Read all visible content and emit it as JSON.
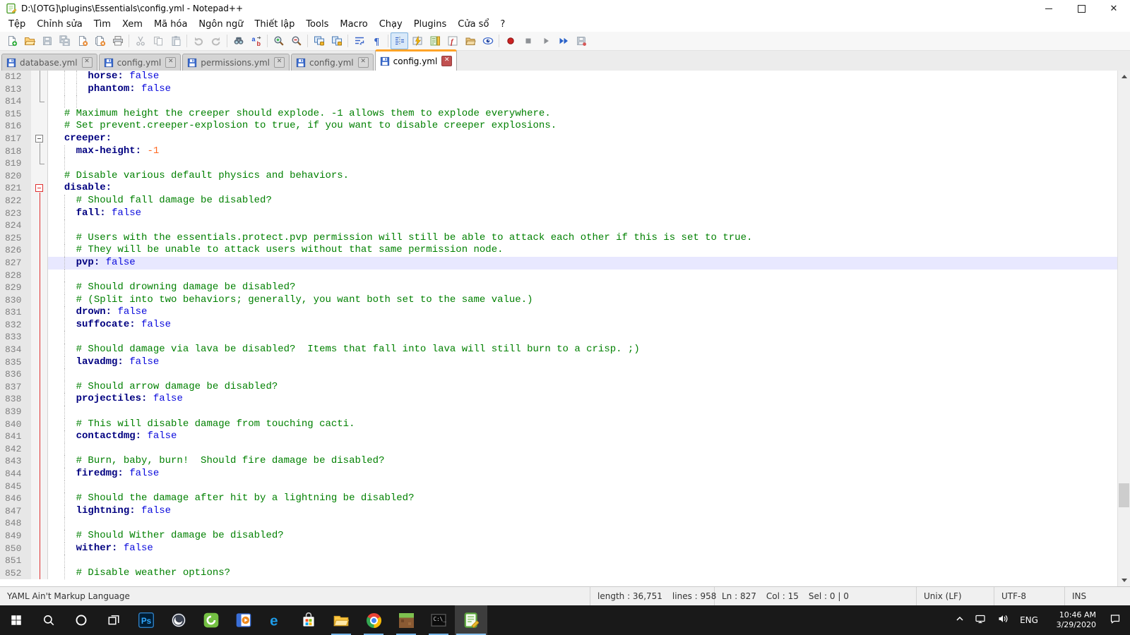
{
  "window": {
    "title": "D:\\[OTG]\\plugins\\Essentials\\config.yml - Notepad++",
    "controls": [
      "minimize",
      "maximize",
      "close"
    ]
  },
  "menu": {
    "items": [
      "Tệp",
      "Chỉnh sửa",
      "Tìm",
      "Xem",
      "Mã hóa",
      "Ngôn ngữ",
      "Thiết lập",
      "Tools",
      "Macro",
      "Chạy",
      "Plugins",
      "Cửa sổ",
      "?"
    ]
  },
  "toolbar": {
    "groups": [
      [
        {
          "n": "new-file",
          "s": ""
        },
        {
          "n": "open-file",
          "s": ""
        },
        {
          "n": "save",
          "s": "d"
        },
        {
          "n": "save-all",
          "s": "d"
        },
        {
          "n": "close-file",
          "s": ""
        },
        {
          "n": "close-all",
          "s": ""
        },
        {
          "n": "print",
          "s": ""
        }
      ],
      [
        {
          "n": "cut",
          "s": "d"
        },
        {
          "n": "copy",
          "s": "d"
        },
        {
          "n": "paste",
          "s": "d"
        }
      ],
      [
        {
          "n": "undo",
          "s": "d"
        },
        {
          "n": "redo",
          "s": "d"
        }
      ],
      [
        {
          "n": "find",
          "s": ""
        },
        {
          "n": "replace",
          "s": ""
        }
      ],
      [
        {
          "n": "zoom-in",
          "s": ""
        },
        {
          "n": "zoom-out",
          "s": ""
        }
      ],
      [
        {
          "n": "sync-vertical",
          "s": ""
        },
        {
          "n": "sync-horizontal",
          "s": ""
        }
      ],
      [
        {
          "n": "word-wrap",
          "s": ""
        },
        {
          "n": "show-all-characters",
          "s": ""
        }
      ],
      [
        {
          "n": "indent-guide",
          "s": "a"
        },
        {
          "n": "launch-run",
          "s": ""
        },
        {
          "n": "document-map",
          "s": ""
        },
        {
          "n": "function-list",
          "s": ""
        },
        {
          "n": "folder-as-workspace",
          "s": ""
        },
        {
          "n": "document-monitor",
          "s": ""
        }
      ],
      [
        {
          "n": "record-macro",
          "s": ""
        },
        {
          "n": "stop-macro",
          "s": "d"
        },
        {
          "n": "play-macro",
          "s": "d"
        },
        {
          "n": "run-macro-multiple",
          "s": ""
        },
        {
          "n": "save-macro",
          "s": "d"
        }
      ]
    ]
  },
  "tabs": [
    {
      "label": "database.yml",
      "active": false
    },
    {
      "label": "config.yml",
      "active": false
    },
    {
      "label": "permissions.yml",
      "active": false
    },
    {
      "label": "config.yml",
      "active": false
    },
    {
      "label": "config.yml",
      "active": true
    }
  ],
  "editor": {
    "lines": [
      {
        "n": "812",
        "f": "gl",
        "g": [
          2,
          4
        ],
        "seg": [
          [
            "      ",
            "d"
          ],
          [
            "horse:",
            "k"
          ],
          [
            " ",
            "d"
          ],
          [
            "false",
            "v"
          ]
        ]
      },
      {
        "n": "813",
        "f": "gl",
        "g": [
          2,
          4
        ],
        "seg": [
          [
            "      ",
            "d"
          ],
          [
            "phantom:",
            "k"
          ],
          [
            " ",
            "d"
          ],
          [
            "false",
            "v"
          ]
        ]
      },
      {
        "n": "814",
        "f": "ge",
        "g": [
          2,
          4
        ],
        "seg": []
      },
      {
        "n": "815",
        "f": "",
        "g": [],
        "seg": [
          [
            "  ",
            "d"
          ],
          [
            "# Maximum height the creeper should explode. -1 allows them to explode everywhere.",
            "c"
          ]
        ]
      },
      {
        "n": "816",
        "f": "",
        "g": [],
        "seg": [
          [
            "  ",
            "d"
          ],
          [
            "# Set prevent.creeper-explosion to true, if you want to disable creeper explosions.",
            "c"
          ]
        ]
      },
      {
        "n": "817",
        "f": "gb",
        "g": [],
        "seg": [
          [
            "  ",
            "d"
          ],
          [
            "creeper:",
            "k"
          ]
        ]
      },
      {
        "n": "818",
        "f": "gl",
        "g": [
          2
        ],
        "seg": [
          [
            "    ",
            "d"
          ],
          [
            "max-height:",
            "k"
          ],
          [
            " ",
            "d"
          ],
          [
            "-1",
            "n"
          ]
        ]
      },
      {
        "n": "819",
        "f": "ge",
        "g": [
          2
        ],
        "seg": []
      },
      {
        "n": "820",
        "f": "",
        "g": [],
        "seg": [
          [
            "  ",
            "d"
          ],
          [
            "# Disable various default physics and behaviors.",
            "c"
          ]
        ]
      },
      {
        "n": "821",
        "f": "rb",
        "g": [],
        "seg": [
          [
            "  ",
            "d"
          ],
          [
            "disable:",
            "k"
          ]
        ]
      },
      {
        "n": "822",
        "f": "rl",
        "g": [
          2
        ],
        "seg": [
          [
            "    ",
            "d"
          ],
          [
            "# Should fall damage be disabled?",
            "c"
          ]
        ]
      },
      {
        "n": "823",
        "f": "rl",
        "g": [
          2
        ],
        "seg": [
          [
            "    ",
            "d"
          ],
          [
            "fall:",
            "k"
          ],
          [
            " ",
            "d"
          ],
          [
            "false",
            "v"
          ]
        ]
      },
      {
        "n": "824",
        "f": "rl",
        "g": [
          2
        ],
        "seg": []
      },
      {
        "n": "825",
        "f": "rl",
        "g": [
          2
        ],
        "seg": [
          [
            "    ",
            "d"
          ],
          [
            "# Users with the essentials.protect.pvp permission will still be able to attack each other if this is set to true.",
            "c"
          ]
        ]
      },
      {
        "n": "826",
        "f": "rl",
        "g": [
          2
        ],
        "seg": [
          [
            "    ",
            "d"
          ],
          [
            "# They will be unable to attack users without that same permission node.",
            "c"
          ]
        ]
      },
      {
        "n": "827",
        "f": "rl",
        "g": [
          2
        ],
        "cur": true,
        "seg": [
          [
            "    ",
            "d"
          ],
          [
            "pvp:",
            "k"
          ],
          [
            " ",
            "d"
          ],
          [
            "false",
            "v"
          ]
        ]
      },
      {
        "n": "828",
        "f": "rl",
        "g": [
          2
        ],
        "seg": []
      },
      {
        "n": "829",
        "f": "rl",
        "g": [
          2
        ],
        "seg": [
          [
            "    ",
            "d"
          ],
          [
            "# Should drowning damage be disabled?",
            "c"
          ]
        ]
      },
      {
        "n": "830",
        "f": "rl",
        "g": [
          2
        ],
        "seg": [
          [
            "    ",
            "d"
          ],
          [
            "# (Split into two behaviors; generally, you want both set to the same value.)",
            "c"
          ]
        ]
      },
      {
        "n": "831",
        "f": "rl",
        "g": [
          2
        ],
        "seg": [
          [
            "    ",
            "d"
          ],
          [
            "drown:",
            "k"
          ],
          [
            " ",
            "d"
          ],
          [
            "false",
            "v"
          ]
        ]
      },
      {
        "n": "832",
        "f": "rl",
        "g": [
          2
        ],
        "seg": [
          [
            "    ",
            "d"
          ],
          [
            "suffocate:",
            "k"
          ],
          [
            " ",
            "d"
          ],
          [
            "false",
            "v"
          ]
        ]
      },
      {
        "n": "833",
        "f": "rl",
        "g": [
          2
        ],
        "seg": []
      },
      {
        "n": "834",
        "f": "rl",
        "g": [
          2
        ],
        "seg": [
          [
            "    ",
            "d"
          ],
          [
            "# Should damage via lava be disabled?  Items that fall into lava will still burn to a crisp. ;)",
            "c"
          ]
        ]
      },
      {
        "n": "835",
        "f": "rl",
        "g": [
          2
        ],
        "seg": [
          [
            "    ",
            "d"
          ],
          [
            "lavadmg:",
            "k"
          ],
          [
            " ",
            "d"
          ],
          [
            "false",
            "v"
          ]
        ]
      },
      {
        "n": "836",
        "f": "rl",
        "g": [
          2
        ],
        "seg": []
      },
      {
        "n": "837",
        "f": "rl",
        "g": [
          2
        ],
        "seg": [
          [
            "    ",
            "d"
          ],
          [
            "# Should arrow damage be disabled?",
            "c"
          ]
        ]
      },
      {
        "n": "838",
        "f": "rl",
        "g": [
          2
        ],
        "seg": [
          [
            "    ",
            "d"
          ],
          [
            "projectiles:",
            "k"
          ],
          [
            " ",
            "d"
          ],
          [
            "false",
            "v"
          ]
        ]
      },
      {
        "n": "839",
        "f": "rl",
        "g": [
          2
        ],
        "seg": []
      },
      {
        "n": "840",
        "f": "rl",
        "g": [
          2
        ],
        "seg": [
          [
            "    ",
            "d"
          ],
          [
            "# This will disable damage from touching cacti.",
            "c"
          ]
        ]
      },
      {
        "n": "841",
        "f": "rl",
        "g": [
          2
        ],
        "seg": [
          [
            "    ",
            "d"
          ],
          [
            "contactdmg:",
            "k"
          ],
          [
            " ",
            "d"
          ],
          [
            "false",
            "v"
          ]
        ]
      },
      {
        "n": "842",
        "f": "rl",
        "g": [
          2
        ],
        "seg": []
      },
      {
        "n": "843",
        "f": "rl",
        "g": [
          2
        ],
        "seg": [
          [
            "    ",
            "d"
          ],
          [
            "# Burn, baby, burn!  Should fire damage be disabled?",
            "c"
          ]
        ]
      },
      {
        "n": "844",
        "f": "rl",
        "g": [
          2
        ],
        "seg": [
          [
            "    ",
            "d"
          ],
          [
            "firedmg:",
            "k"
          ],
          [
            " ",
            "d"
          ],
          [
            "false",
            "v"
          ]
        ]
      },
      {
        "n": "845",
        "f": "rl",
        "g": [
          2
        ],
        "seg": []
      },
      {
        "n": "846",
        "f": "rl",
        "g": [
          2
        ],
        "seg": [
          [
            "    ",
            "d"
          ],
          [
            "# Should the damage after hit by a lightning be disabled?",
            "c"
          ]
        ]
      },
      {
        "n": "847",
        "f": "rl",
        "g": [
          2
        ],
        "seg": [
          [
            "    ",
            "d"
          ],
          [
            "lightning:",
            "k"
          ],
          [
            " ",
            "d"
          ],
          [
            "false",
            "v"
          ]
        ]
      },
      {
        "n": "848",
        "f": "rl",
        "g": [
          2
        ],
        "seg": []
      },
      {
        "n": "849",
        "f": "rl",
        "g": [
          2
        ],
        "seg": [
          [
            "    ",
            "d"
          ],
          [
            "# Should Wither damage be disabled?",
            "c"
          ]
        ]
      },
      {
        "n": "850",
        "f": "rl",
        "g": [
          2
        ],
        "seg": [
          [
            "    ",
            "d"
          ],
          [
            "wither:",
            "k"
          ],
          [
            " ",
            "d"
          ],
          [
            "false",
            "v"
          ]
        ]
      },
      {
        "n": "851",
        "f": "rl",
        "g": [
          2
        ],
        "seg": []
      },
      {
        "n": "852",
        "f": "rl",
        "g": [
          2
        ],
        "seg": [
          [
            "    ",
            "d"
          ],
          [
            "# Disable weather options?",
            "c"
          ]
        ]
      }
    ]
  },
  "status": {
    "doc_type": "YAML Ain't Markup Language",
    "length": "length : 36,751",
    "lines": "lines : 958",
    "ln": "Ln : 827",
    "col": "Col : 15",
    "sel": "Sel : 0 | 0",
    "eol": "Unix (LF)",
    "encoding": "UTF-8",
    "mode": "INS"
  },
  "taskbar": {
    "apps": [
      {
        "name": "start",
        "running": false,
        "active": false
      },
      {
        "name": "search",
        "running": false,
        "active": false
      },
      {
        "name": "cortana",
        "running": false,
        "active": false
      },
      {
        "name": "task-view",
        "running": false,
        "active": false
      },
      {
        "name": "photoshop",
        "running": false,
        "active": false
      },
      {
        "name": "obs-studio",
        "running": false,
        "active": false
      },
      {
        "name": "camtasia",
        "running": false,
        "active": false
      },
      {
        "name": "video-player",
        "running": false,
        "active": false
      },
      {
        "name": "edge",
        "running": false,
        "active": false
      },
      {
        "name": "microsoft-store",
        "running": false,
        "active": false
      },
      {
        "name": "file-explorer",
        "running": true,
        "active": false
      },
      {
        "name": "chrome",
        "running": true,
        "active": false
      },
      {
        "name": "minecraft",
        "running": true,
        "active": false
      },
      {
        "name": "command-prompt",
        "running": true,
        "active": false
      },
      {
        "name": "notepad-plus-plus",
        "running": true,
        "active": true
      }
    ],
    "tray": {
      "language": "ENG",
      "time": "10:46 AM",
      "date": "3/29/2020"
    }
  }
}
